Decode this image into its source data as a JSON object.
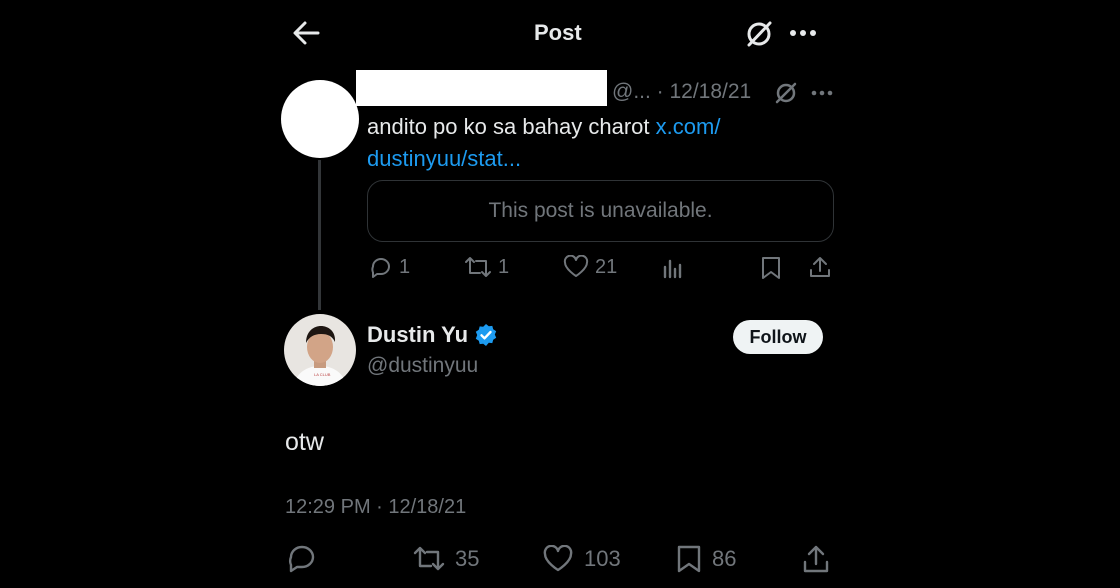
{
  "header": {
    "title": "Post",
    "back_icon": "arrow-left-icon",
    "grok_icon": "slash-circle-icon",
    "more_icon": "more-icon"
  },
  "quoted_post": {
    "handle_date": "@... · 12/18/21",
    "text": "andito po ko sa bahay charot ",
    "link": "x.com/ dustinyuu/stat...",
    "link_line1": "x.com/",
    "link_line2": "dustinyuu/stat...",
    "unavailable": "This post is unavailable.",
    "replies": "1",
    "reposts": "1",
    "likes": "21"
  },
  "main_post": {
    "name": "Dustin Yu",
    "handle": "@dustinyuu",
    "follow_label": "Follow",
    "text": "otw",
    "timestamp": "12:29 PM · 12/18/21",
    "reposts": "35",
    "likes": "103",
    "bookmarks": "86"
  },
  "colors": {
    "background": "#000000",
    "link": "#1d9bf0",
    "verified": "#1d9bf0",
    "secondary_text": "#71767b"
  }
}
